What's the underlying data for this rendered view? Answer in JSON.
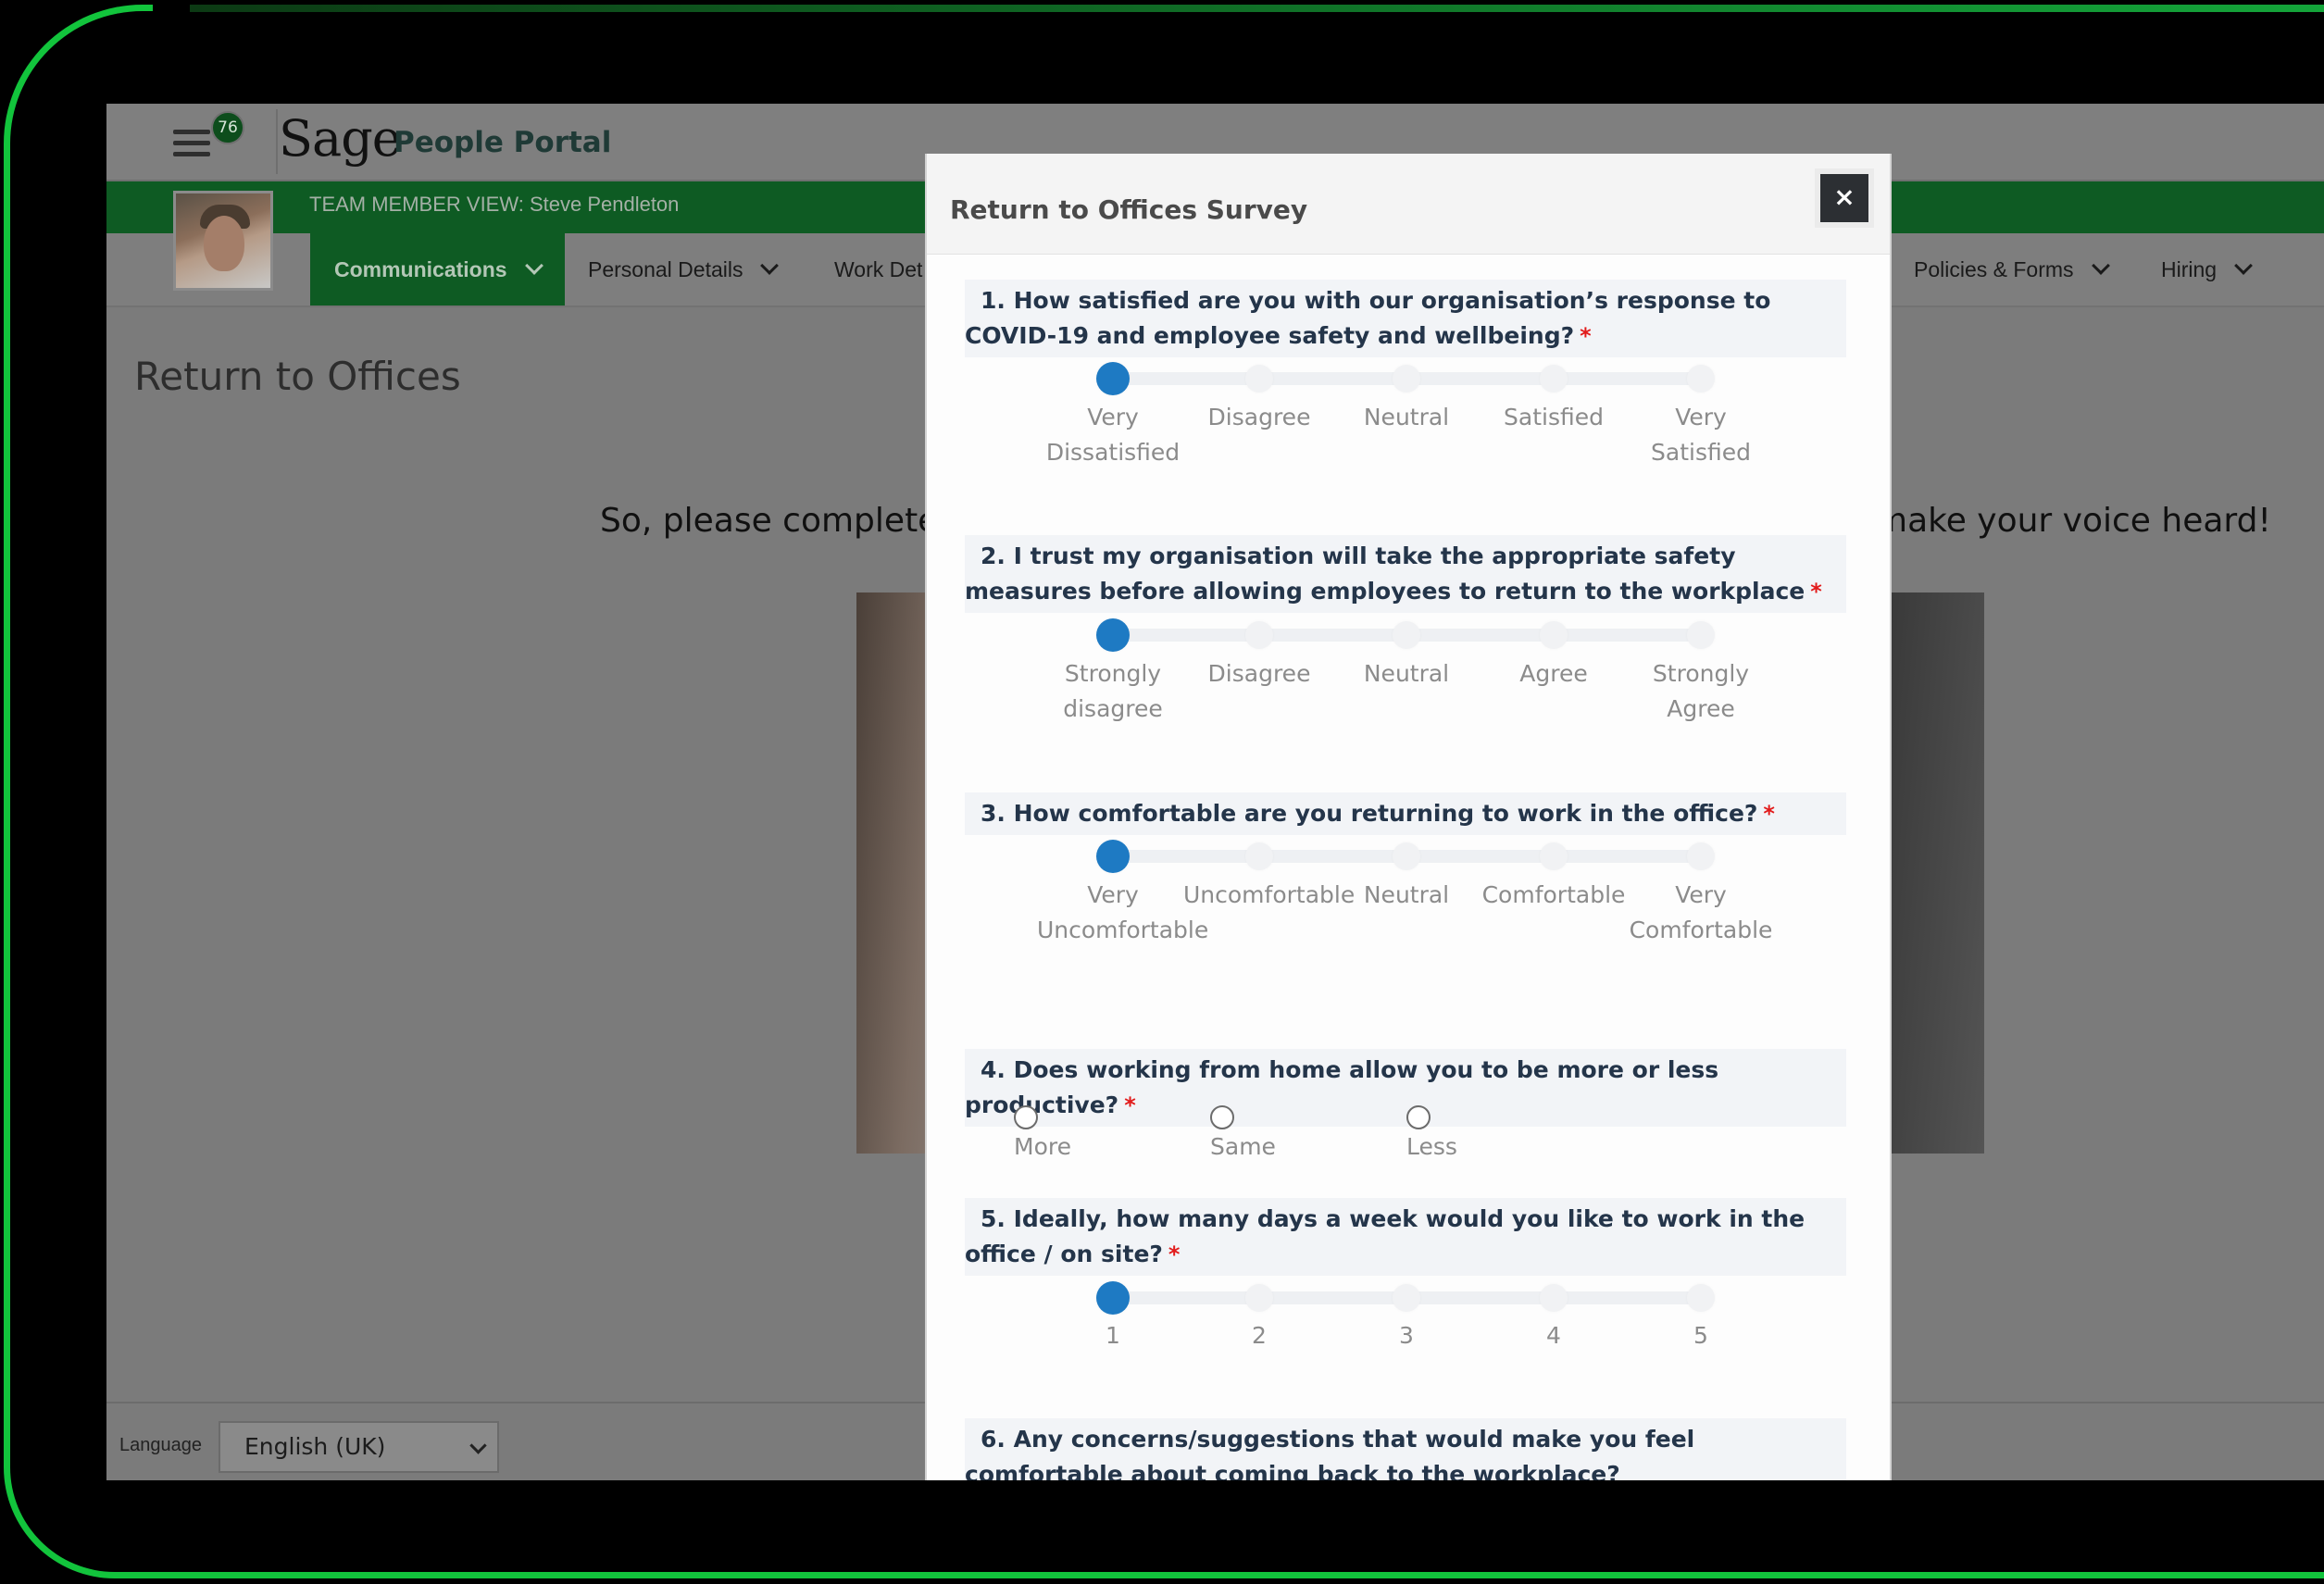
{
  "app": {
    "notification_count": "76",
    "logo": "Sage",
    "portal_name": "People Portal",
    "team_member_view": "TEAM MEMBER VIEW: Steve Pendleton"
  },
  "nav": {
    "items": [
      "Communications",
      "Personal Details",
      "Work Det",
      "Policies & Forms",
      "Hiring"
    ]
  },
  "page": {
    "title": "Return to Offices",
    "intro_left": "So, please complete",
    "intro_right": "make your voice heard!"
  },
  "footer": {
    "language_label": "Language",
    "language_value": "English (UK)"
  },
  "modal": {
    "title": "Return to Offices Survey",
    "close_label": "×",
    "required_mark": "*",
    "questions": [
      {
        "number": "1.",
        "text": "How satisfied are you with our organisation’s response to COVID-19 and employee safety and wellbeing?",
        "type": "slider",
        "options": [
          "Very Dissatisfied",
          "Disagree",
          "Neutral",
          "Satisfied",
          "Very Satisfied"
        ],
        "selected_index": 0
      },
      {
        "number": "2.",
        "text": "I trust my organisation will take the appropriate safety measures before allowing employees to return to the workplace",
        "type": "slider",
        "options": [
          "Strongly disagree",
          "Disagree",
          "Neutral",
          "Agree",
          "Strongly Agree"
        ],
        "selected_index": 0
      },
      {
        "number": "3.",
        "text": "How comfortable are you returning to work in the office?",
        "type": "slider",
        "options": [
          "Very Uncomfortable",
          "Uncomfortable",
          "Neutral",
          "Comfortable",
          "Very Comfortable"
        ],
        "selected_index": 0
      },
      {
        "number": "4.",
        "text": "Does working from home allow you to be more or less productive?",
        "type": "radio",
        "options": [
          "More",
          "Same",
          "Less"
        ]
      },
      {
        "number": "5.",
        "text": "Ideally, how many days a week would you like to work in the office / on site?",
        "type": "slider",
        "options": [
          "1",
          "2",
          "3",
          "4",
          "5"
        ],
        "selected_index": 0
      },
      {
        "number": "6.",
        "text": "Any concerns/suggestions that would make you feel comfortable about coming back to the workplace?"
      }
    ]
  },
  "colors": {
    "frame_green": "#12c43c",
    "brand_green": "#0e5b23",
    "slider_selected": "#1e7ac3",
    "required": "#e21b1b"
  }
}
